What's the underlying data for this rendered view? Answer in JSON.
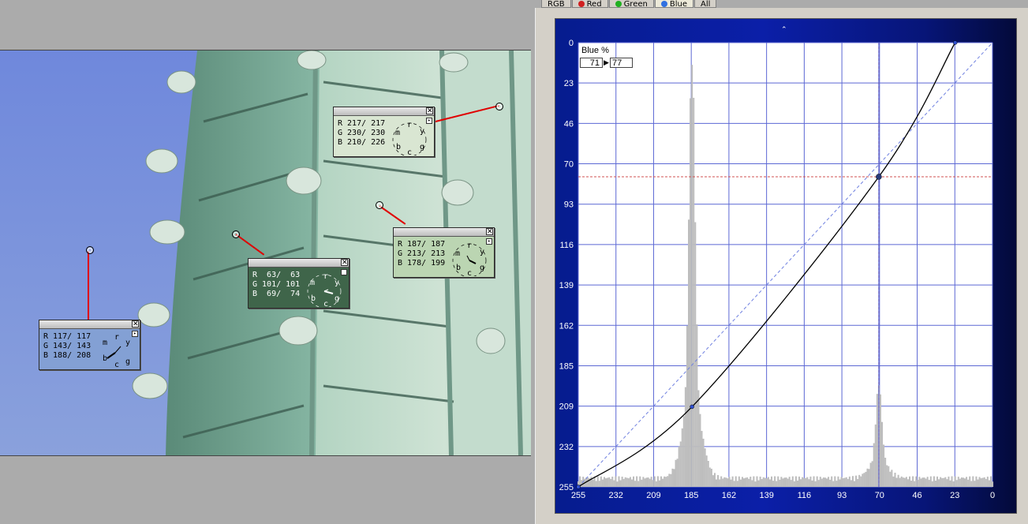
{
  "readouts": [
    {
      "r": "R 117/ 117",
      "g": "G 143/ 143",
      "b": "B 188/ 208",
      "bg": "#83a0d4"
    },
    {
      "r": "R  63/  63",
      "g": "G 101/ 101",
      "b": "B  69/  74",
      "bg": "#3f654a"
    },
    {
      "r": "R 217/ 217",
      "g": "G 230/ 230",
      "b": "B 210/ 226",
      "bg": "#d9e6d2"
    },
    {
      "r": "R 187/ 187",
      "g": "G 213/ 213",
      "b": "B 178/ 199",
      "bg": "#bbd5b2"
    }
  ],
  "dial_letters": [
    "m",
    "r",
    "y",
    "b",
    "c",
    "g"
  ],
  "tabs": [
    {
      "label": "RGB",
      "dot": ""
    },
    {
      "label": "Red",
      "dot": "#d02020"
    },
    {
      "label": "Green",
      "dot": "#20b020"
    },
    {
      "label": "Blue",
      "dot": "#3070e0"
    },
    {
      "label": "All",
      "dot": ""
    }
  ],
  "curve": {
    "channel_label": "Blue %",
    "input_value": "71",
    "output_value": "77",
    "axis_ticks": [
      "255",
      "232",
      "209",
      "185",
      "162",
      "139",
      "116",
      "93",
      "70",
      "46",
      "23",
      "0"
    ],
    "y_ticks": [
      "0",
      "23",
      "46",
      "70",
      "93",
      "116",
      "139",
      "162",
      "185",
      "209",
      "232",
      "255"
    ],
    "points": [
      [
        255,
        255
      ],
      [
        185,
        209
      ],
      [
        70,
        77
      ],
      [
        23,
        0
      ]
    ],
    "selected_point": [
      70,
      77
    ],
    "histogram_peaks": [
      [
        185,
        0.78
      ],
      [
        70,
        0.17
      ]
    ],
    "colors": {
      "grid": "#5c68d4",
      "curve": "#000000",
      "diagonal": "#6f80e0",
      "guide": "#d05050",
      "histogram": "#bdbdbd"
    }
  }
}
